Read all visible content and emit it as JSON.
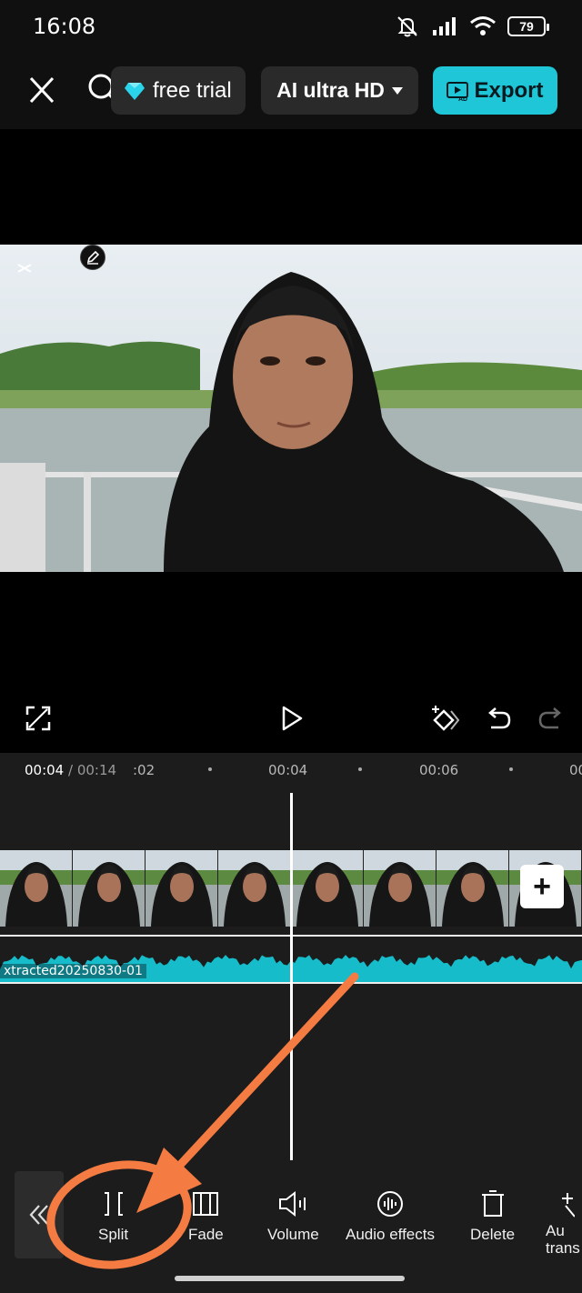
{
  "status_bar": {
    "time": "16:08",
    "battery": "79"
  },
  "top_bar": {
    "free_trial_label": "free trial",
    "quality_label": "AI ultra HD",
    "export_label": "Export"
  },
  "timeline": {
    "current_time": "00:04",
    "total_time": "/ 00:14",
    "ruler_ticks": [
      ":02",
      "00:04",
      "00:06",
      "00"
    ],
    "audio_clip_label": "xtracted20250830-01"
  },
  "toolbar": {
    "tools": [
      {
        "label": "Split",
        "icon": "split-icon"
      },
      {
        "label": "Fade",
        "icon": "fade-icon"
      },
      {
        "label": "Volume",
        "icon": "volume-icon"
      },
      {
        "label": "Audio effects",
        "icon": "audio-effects-icon"
      },
      {
        "label": "Delete",
        "icon": "delete-icon"
      },
      {
        "label": "Au\ntrans",
        "icon": "audio-transcribe-icon"
      }
    ]
  },
  "colors": {
    "accent": "#1ec6d8",
    "annotation": "#f47b42",
    "audio_wave": "#17bccb"
  }
}
